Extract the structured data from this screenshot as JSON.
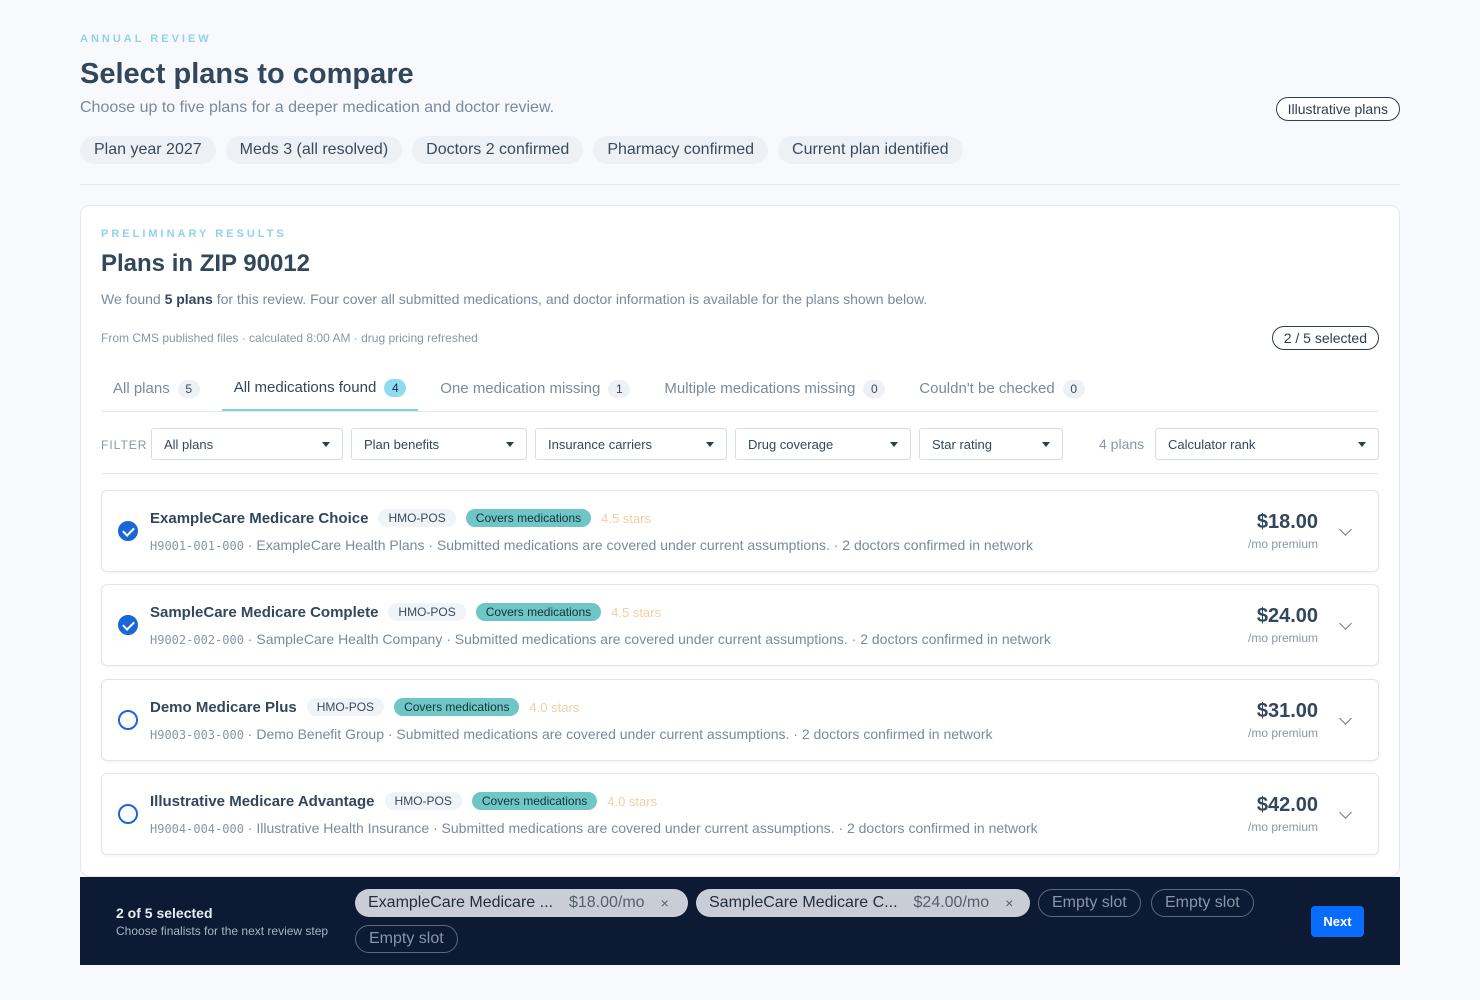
{
  "header": {
    "eyebrow": "ANNUAL REVIEW",
    "title": "Select plans to compare",
    "subtitle": "Choose up to five plans for a deeper medication and doctor review.",
    "badge": "Illustrative plans",
    "chips": [
      "Plan year 2027",
      "Meds 3 (all resolved)",
      "Doctors 2 confirmed",
      "Pharmacy confirmed",
      "Current plan identified"
    ]
  },
  "results": {
    "eyebrow": "PRELIMINARY RESULTS",
    "title": "Plans in ZIP 90012",
    "desc_pre": "We found ",
    "desc_bold": "5 plans",
    "desc_post": " for this review. Four cover all submitted medications, and doctor information is available for the plans shown below.",
    "meta": "From CMS published files · calculated 8:00 AM · drug pricing refreshed",
    "selected_badge": "2 / 5 selected",
    "tabs": [
      {
        "label": "All plans",
        "count": "5"
      },
      {
        "label": "All medications found",
        "count": "4"
      },
      {
        "label": "One medication missing",
        "count": "1"
      },
      {
        "label": "Multiple medications missing",
        "count": "0"
      },
      {
        "label": "Couldn't be checked",
        "count": "0"
      }
    ],
    "filter_label": "FILTER",
    "filters": [
      "All plans",
      "Plan benefits",
      "Insurance carriers",
      "Drug coverage",
      "Star rating"
    ],
    "plan_count": "4 plans",
    "sort": "Calculator rank",
    "plans": [
      {
        "name": "ExampleCare Medicare Choice",
        "type": "HMO-POS",
        "coverage": "Covers medications",
        "stars": "4.5 stars",
        "id": "H9001-001-000",
        "details": " · ExampleCare Health Plans · Submitted medications are covered under current assumptions. · 2 doctors confirmed in network",
        "price": "$18.00",
        "unit": "/mo premium",
        "selected": true
      },
      {
        "name": "SampleCare Medicare Complete",
        "type": "HMO-POS",
        "coverage": "Covers medications",
        "stars": "4.5 stars",
        "id": "H9002-002-000",
        "details": " · SampleCare Health Company · Submitted medications are covered under current assumptions. · 2 doctors confirmed in network",
        "price": "$24.00",
        "unit": "/mo premium",
        "selected": true
      },
      {
        "name": "Demo Medicare Plus",
        "type": "HMO-POS",
        "coverage": "Covers medications",
        "stars": "4.0 stars",
        "id": "H9003-003-000",
        "details": " · Demo Benefit Group · Submitted medications are covered under current assumptions. · 2 doctors confirmed in network",
        "price": "$31.00",
        "unit": "/mo premium",
        "selected": false
      },
      {
        "name": "Illustrative Medicare Advantage",
        "type": "HMO-POS",
        "coverage": "Covers medications",
        "stars": "4.0 stars",
        "id": "H9004-004-000",
        "details": " · Illustrative Health Insurance · Submitted medications are covered under current assumptions. · 2 doctors confirmed in network",
        "price": "$42.00",
        "unit": "/mo premium",
        "selected": false
      }
    ]
  },
  "footer": {
    "title": "2 of 5 selected",
    "subtitle": "Choose finalists for the next review step",
    "slots": [
      {
        "name": "ExampleCare Medicare ...",
        "price": "$18.00/mo",
        "remove": "×"
      },
      {
        "name": "SampleCare Medicare C...",
        "price": "$24.00/mo",
        "remove": "×"
      }
    ],
    "empty_slot": "Empty slot",
    "next": "Next"
  },
  "colors": {
    "accent": "#0a6cff",
    "check": "#1a67d8",
    "footer_bg": "#0c1a33",
    "coverage_tag": "#6fc6c6"
  }
}
